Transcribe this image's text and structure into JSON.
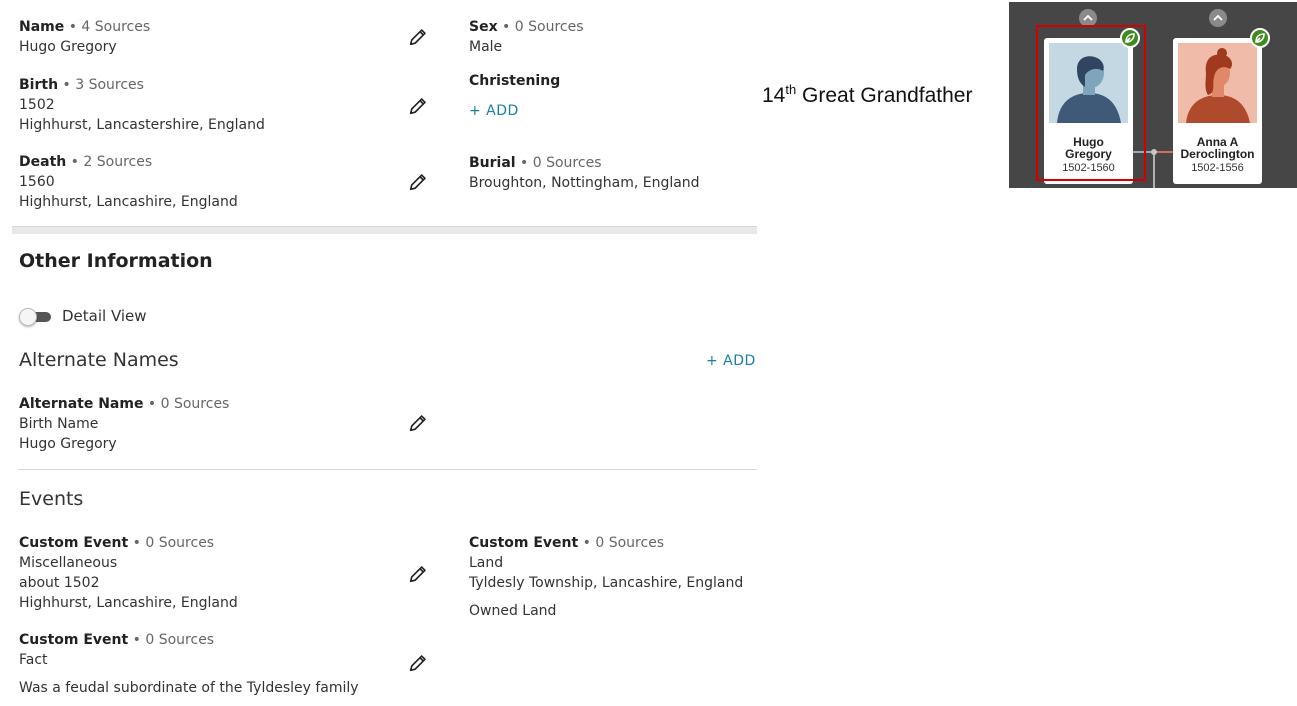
{
  "vitals": {
    "name": {
      "title": "Name",
      "sources": " • 4 Sources",
      "value": "Hugo Gregory"
    },
    "sex": {
      "title": "Sex",
      "sources": " • 0 Sources",
      "value": "Male"
    },
    "birth": {
      "title": "Birth",
      "sources": " • 3 Sources",
      "date": "1502",
      "place": "Highhurst, Lancastershire, England"
    },
    "christening": {
      "title": "Christening",
      "add": "+ ADD"
    },
    "death": {
      "title": "Death",
      "sources": " • 2 Sources",
      "date": "1560",
      "place": "Highhurst, Lancashire, England"
    },
    "burial": {
      "title": "Burial",
      "sources": " • 0 Sources",
      "place": "Broughton, Nottingham, England"
    }
  },
  "other_information": {
    "title": "Other Information",
    "detail_view_label": "Detail View",
    "detail_view_on": false
  },
  "alternate_names": {
    "title": "Alternate Names",
    "add": "+ ADD",
    "item": {
      "title": "Alternate Name",
      "sources": " • 0 Sources",
      "type": "Birth Name",
      "value": "Hugo Gregory"
    }
  },
  "events": {
    "title": "Events",
    "items": [
      {
        "title": "Custom Event",
        "sources": " • 0 Sources",
        "type": "Miscellaneous",
        "date": "about 1502",
        "place": "Highhurst, Lancashire, England"
      },
      {
        "title": "Custom Event",
        "sources": " • 0 Sources",
        "type": "Land",
        "place": "Tyldesly Township, Lancashire, England",
        "description": "Owned Land"
      },
      {
        "title": "Custom Event",
        "sources": " • 0 Sources",
        "type": "Fact",
        "description": "Was a feudal subordinate of the Tyldesley family"
      }
    ]
  },
  "relationship": {
    "ordinal": "14",
    "suffix": "th",
    "label": " Great Grandfather"
  },
  "tree": {
    "father": {
      "first": "Hugo",
      "last": "Gregory",
      "dates": "1502-1560"
    },
    "mother": {
      "first": "Anna A",
      "last": "Deroclington",
      "dates": "1502-1556"
    }
  },
  "colors": {
    "link": "#1a7fa0",
    "hint_leaf": "#3b8c1a",
    "selection": "#d40000",
    "tree_bg": "#464646"
  },
  "icons": {
    "edit": "pencil-icon",
    "expand_up": "chevron-up-icon",
    "hint": "leaf-hint-icon"
  }
}
